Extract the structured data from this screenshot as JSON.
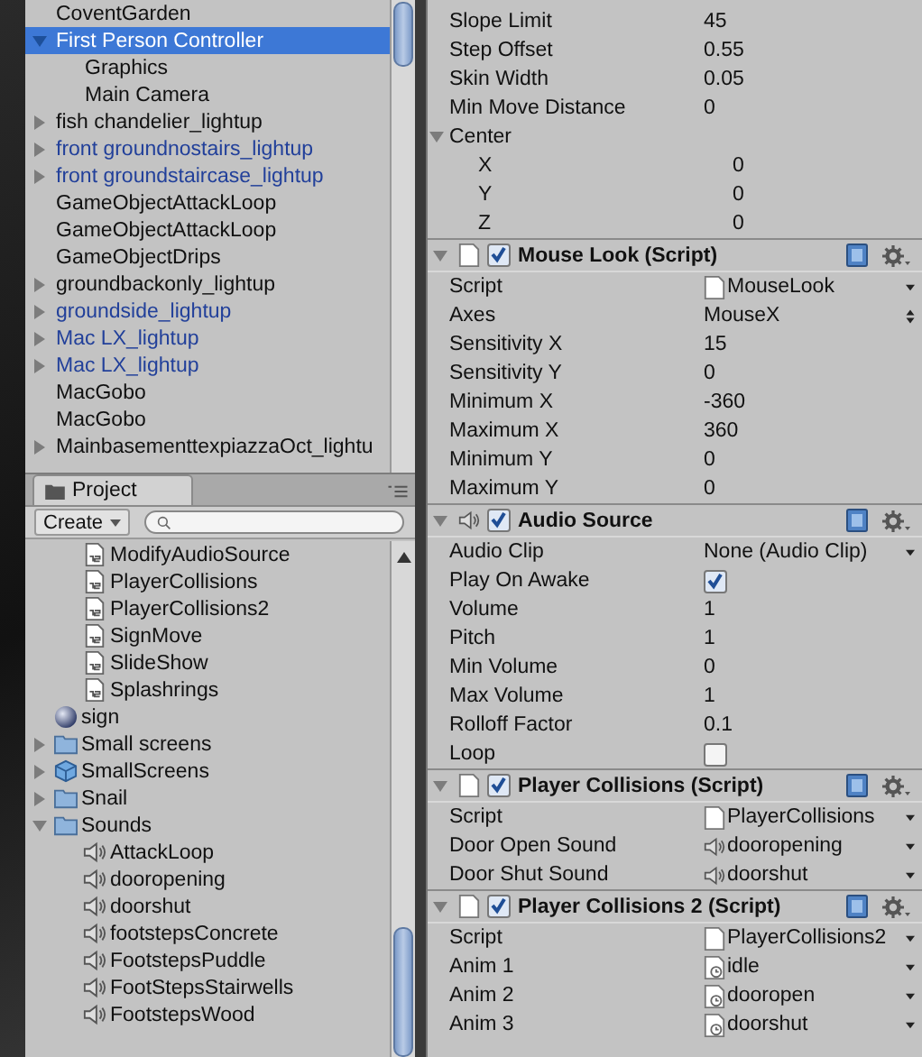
{
  "hierarchy": {
    "items": [
      {
        "label": "CoventGarden",
        "prefab": false,
        "selected": false
      },
      {
        "label": "First Person Controller",
        "expanded": true,
        "prefab": false,
        "selected": true,
        "children": [
          {
            "label": "Graphics",
            "prefab": false,
            "selected": false
          },
          {
            "label": "Main Camera",
            "prefab": false,
            "selected": false
          }
        ]
      },
      {
        "label": "fish chandelier_lightup",
        "expanded": false,
        "prefab": false,
        "selected": false
      },
      {
        "label": "front groundnostairs_lightup",
        "expanded": false,
        "prefab": true,
        "selected": false
      },
      {
        "label": "front groundstaircase_lightup",
        "expanded": false,
        "prefab": true,
        "selected": false
      },
      {
        "label": "GameObjectAttackLoop",
        "prefab": false,
        "selected": false
      },
      {
        "label": "GameObjectAttackLoop",
        "prefab": false,
        "selected": false
      },
      {
        "label": "GameObjectDrips",
        "prefab": false,
        "selected": false
      },
      {
        "label": "groundbackonly_lightup",
        "expanded": false,
        "prefab": false,
        "selected": false
      },
      {
        "label": "groundside_lightup",
        "expanded": false,
        "prefab": true,
        "selected": false
      },
      {
        "label": "Mac LX_lightup",
        "expanded": false,
        "prefab": true,
        "selected": false
      },
      {
        "label": "Mac LX_lightup",
        "expanded": false,
        "prefab": true,
        "selected": false
      },
      {
        "label": "MacGobo",
        "prefab": false,
        "selected": false
      },
      {
        "label": "MacGobo",
        "prefab": false,
        "selected": false
      },
      {
        "label": "MainbasementtexpiazzaOct_lightu",
        "expanded": false,
        "prefab": false,
        "selected": false
      }
    ]
  },
  "project": {
    "tab": "Project",
    "create_button": "Create",
    "items": [
      {
        "children": [
          {
            "label": "ModifyAudioSource",
            "kind": "script"
          },
          {
            "label": "PlayerCollisions",
            "kind": "script"
          },
          {
            "label": "PlayerCollisions2",
            "kind": "script"
          },
          {
            "label": "SignMove",
            "kind": "script"
          },
          {
            "label": "SlideShow",
            "kind": "script"
          },
          {
            "label": "Splashrings",
            "kind": "script"
          }
        ]
      },
      {
        "label": "sign",
        "kind": "material"
      },
      {
        "label": "Small screens",
        "kind": "folder",
        "expanded": false
      },
      {
        "label": "SmallScreens",
        "kind": "prefab",
        "expanded": false
      },
      {
        "label": "Snail",
        "kind": "folder",
        "expanded": false
      },
      {
        "label": "Sounds",
        "kind": "folder",
        "expanded": true,
        "children": [
          {
            "label": "AttackLoop",
            "kind": "audio"
          },
          {
            "label": "dooropening",
            "kind": "audio"
          },
          {
            "label": "doorshut",
            "kind": "audio"
          },
          {
            "label": "footstepsConcrete",
            "kind": "audio"
          },
          {
            "label": "FootstepsPuddle",
            "kind": "audio"
          },
          {
            "label": "FootStepsStairwells",
            "kind": "audio"
          },
          {
            "label": "FootstepsWood",
            "kind": "audio"
          }
        ]
      }
    ]
  },
  "inspector": {
    "components": [
      {
        "fields": [
          {
            "label": "Slope Limit",
            "value": "45",
            "kind": "text"
          },
          {
            "label": "Step Offset",
            "value": "0.55",
            "kind": "text"
          },
          {
            "label": "Skin Width",
            "value": "0.05",
            "kind": "text"
          },
          {
            "label": "Min Move Distance",
            "value": "0",
            "kind": "text"
          },
          {
            "label": "Center",
            "kind": "group",
            "expanded": true,
            "children": [
              {
                "label": "X",
                "value": "0",
                "kind": "text"
              },
              {
                "label": "Y",
                "value": "0",
                "kind": "text"
              },
              {
                "label": "Z",
                "value": "0",
                "kind": "text"
              }
            ]
          }
        ]
      },
      {
        "title": "Mouse Look (Script)",
        "kind": "script",
        "enabled": true,
        "expanded": true,
        "fields": [
          {
            "label": "Script",
            "value": "MouseLook",
            "kind": "script"
          },
          {
            "label": "Axes",
            "value": "MouseX",
            "kind": "enum"
          },
          {
            "label": "Sensitivity X",
            "value": "15",
            "kind": "text"
          },
          {
            "label": "Sensitivity Y",
            "value": "0",
            "kind": "text"
          },
          {
            "label": "Minimum X",
            "value": "-360",
            "kind": "text"
          },
          {
            "label": "Maximum X",
            "value": "360",
            "kind": "text"
          },
          {
            "label": "Minimum Y",
            "value": "0",
            "kind": "text"
          },
          {
            "label": "Maximum Y",
            "value": "0",
            "kind": "text"
          }
        ]
      },
      {
        "title": "Audio Source",
        "kind": "audio",
        "enabled": true,
        "expanded": true,
        "fields": [
          {
            "label": "Audio Clip",
            "value": "None (Audio Clip)",
            "kind": "object"
          },
          {
            "label": "Play On Awake",
            "kind": "checkbox",
            "checked": true
          },
          {
            "label": "Volume",
            "value": "1",
            "kind": "text"
          },
          {
            "label": "Pitch",
            "value": "1",
            "kind": "text"
          },
          {
            "label": "Min Volume",
            "value": "0",
            "kind": "text"
          },
          {
            "label": "Max Volume",
            "value": "1",
            "kind": "text"
          },
          {
            "label": "Rolloff Factor",
            "value": "0.1",
            "kind": "text"
          },
          {
            "label": "Loop",
            "kind": "checkbox",
            "checked": false
          }
        ]
      },
      {
        "title": "Player Collisions (Script)",
        "kind": "script",
        "enabled": true,
        "expanded": true,
        "fields": [
          {
            "label": "Script",
            "value": "PlayerCollisions",
            "kind": "script"
          },
          {
            "label": "Door Open Sound",
            "value": "dooropening",
            "kind": "audio"
          },
          {
            "label": "Door Shut Sound",
            "value": "doorshut",
            "kind": "audio"
          }
        ]
      },
      {
        "title": "Player Collisions 2 (Script)",
        "kind": "script",
        "enabled": true,
        "expanded": true,
        "fields": [
          {
            "label": "Script",
            "value": "PlayerCollisions2",
            "kind": "script"
          },
          {
            "label": "Anim 1",
            "value": "idle",
            "kind": "anim"
          },
          {
            "label": "Anim 2",
            "value": "dooropen",
            "kind": "anim"
          },
          {
            "label": "Anim 3",
            "value": "doorshut",
            "kind": "anim"
          }
        ]
      }
    ]
  }
}
